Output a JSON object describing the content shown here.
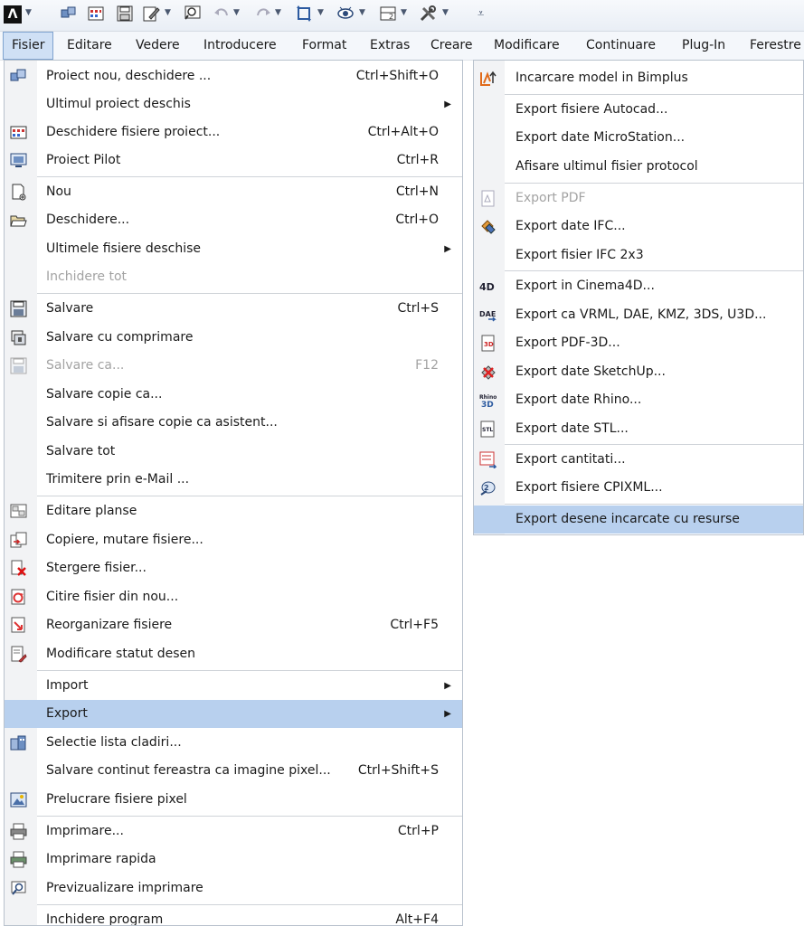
{
  "toolbar": {
    "logo": "Λ",
    "icons": [
      "cube-stack-icon",
      "grid-icon",
      "save-icon",
      "edit-icon",
      "search-icon",
      "undo-icon",
      "redo-icon",
      "rotate-icon",
      "eye-icon",
      "layer-icon",
      "tools-icon",
      "customize-icon"
    ]
  },
  "menubar": {
    "items": [
      "Fisier",
      "Editare",
      "Vedere",
      "Introducere",
      "Format",
      "Extras",
      "Creare",
      "Modificare",
      "Continuare",
      "Plug-In",
      "Ferestre"
    ]
  },
  "file_menu": {
    "items": [
      {
        "label": "Proiect nou, deschidere ...",
        "shortcut": "Ctrl+Shift+O",
        "icon": "project-icon",
        "disabled": false,
        "submenu": false
      },
      {
        "label": "Ultimul proiect deschis",
        "shortcut": "",
        "icon": "",
        "disabled": false,
        "submenu": true
      },
      {
        "label": "Deschidere fisiere proiect...",
        "shortcut": "Ctrl+Alt+O",
        "icon": "grid-icon",
        "disabled": false,
        "submenu": false
      },
      {
        "label": "Proiect Pilot",
        "shortcut": "Ctrl+R",
        "icon": "pilot-icon",
        "disabled": false,
        "submenu": false
      },
      {
        "label": "Nou",
        "shortcut": "Ctrl+N",
        "icon": "new-file-icon",
        "disabled": false,
        "submenu": false
      },
      {
        "label": "Deschidere...",
        "shortcut": "Ctrl+O",
        "icon": "open-folder-icon",
        "disabled": false,
        "submenu": false
      },
      {
        "label": "Ultimele fisiere deschise",
        "shortcut": "",
        "icon": "",
        "disabled": false,
        "submenu": true
      },
      {
        "label": "Inchidere tot",
        "shortcut": "",
        "icon": "",
        "disabled": true,
        "submenu": false
      },
      {
        "label": "Salvare",
        "shortcut": "Ctrl+S",
        "icon": "save-icon",
        "disabled": false,
        "submenu": false
      },
      {
        "label": "Salvare cu comprimare",
        "shortcut": "",
        "icon": "compress-icon",
        "disabled": false,
        "submenu": false
      },
      {
        "label": "Salvare ca...",
        "shortcut": "F12",
        "icon": "save-as-icon",
        "disabled": true,
        "submenu": false
      },
      {
        "label": "Salvare copie ca...",
        "shortcut": "",
        "icon": "",
        "disabled": false,
        "submenu": false
      },
      {
        "label": "Salvare si afisare copie ca asistent...",
        "shortcut": "",
        "icon": "",
        "disabled": false,
        "submenu": false
      },
      {
        "label": "Salvare tot",
        "shortcut": "",
        "icon": "",
        "disabled": false,
        "submenu": false
      },
      {
        "label": "Trimitere prin e-Mail ...",
        "shortcut": "",
        "icon": "",
        "disabled": false,
        "submenu": false
      },
      {
        "label": "Editare planse",
        "shortcut": "",
        "icon": "sheets-icon",
        "disabled": false,
        "submenu": false
      },
      {
        "label": "Copiere, mutare fisiere...",
        "shortcut": "",
        "icon": "copy-move-icon",
        "disabled": false,
        "submenu": false
      },
      {
        "label": "Stergere fisier...",
        "shortcut": "",
        "icon": "delete-file-icon",
        "disabled": false,
        "submenu": false
      },
      {
        "label": "Citire fisier din nou...",
        "shortcut": "",
        "icon": "reload-icon",
        "disabled": false,
        "submenu": false
      },
      {
        "label": "Reorganizare fisiere",
        "shortcut": "Ctrl+F5",
        "icon": "reorganize-icon",
        "disabled": false,
        "submenu": false
      },
      {
        "label": "Modificare statut desen",
        "shortcut": "",
        "icon": "status-icon",
        "disabled": false,
        "submenu": false
      },
      {
        "label": "Import",
        "shortcut": "",
        "icon": "",
        "disabled": false,
        "submenu": true
      },
      {
        "label": "Export",
        "shortcut": "",
        "icon": "",
        "disabled": false,
        "submenu": true,
        "highlighted": true
      },
      {
        "label": "Selectie lista cladiri...",
        "shortcut": "",
        "icon": "buildings-icon",
        "disabled": false,
        "submenu": false
      },
      {
        "label": "Salvare continut fereastra ca imagine pixel...",
        "shortcut": "Ctrl+Shift+S",
        "icon": "",
        "disabled": false,
        "submenu": false
      },
      {
        "label": "Prelucrare fisiere pixel",
        "shortcut": "",
        "icon": "image-icon",
        "disabled": false,
        "submenu": false
      },
      {
        "label": "Imprimare...",
        "shortcut": "Ctrl+P",
        "icon": "print-icon",
        "disabled": false,
        "submenu": false
      },
      {
        "label": "Imprimare rapida",
        "shortcut": "",
        "icon": "quick-print-icon",
        "disabled": false,
        "submenu": false
      },
      {
        "label": "Previzualizare imprimare",
        "shortcut": "",
        "icon": "print-preview-icon",
        "disabled": false,
        "submenu": false
      },
      {
        "label": "Inchidere program",
        "shortcut": "Alt+F4",
        "icon": "",
        "disabled": false,
        "submenu": false
      }
    ]
  },
  "export_submenu": {
    "items": [
      {
        "label": "Incarcare model in Bimplus",
        "icon": "bimplus-upload-icon",
        "disabled": false
      },
      {
        "label": "Export fisiere Autocad...",
        "icon": "",
        "disabled": false
      },
      {
        "label": "Export date MicroStation...",
        "icon": "",
        "disabled": false
      },
      {
        "label": "Afisare ultimul fisier protocol",
        "icon": "",
        "disabled": false
      },
      {
        "label": "Export PDF",
        "icon": "pdf-icon",
        "disabled": true
      },
      {
        "label": "Export date IFC...",
        "icon": "ifc-icon",
        "disabled": false
      },
      {
        "label": "Export  fisier IFC 2x3",
        "icon": "",
        "disabled": false
      },
      {
        "label": "Export in Cinema4D...",
        "icon": "cinema4d-icon",
        "disabled": false
      },
      {
        "label": "Export ca VRML, DAE, KMZ, 3DS, U3D...",
        "icon": "dae-icon",
        "disabled": false
      },
      {
        "label": "Export PDF-3D...",
        "icon": "pdf-3d-icon",
        "disabled": false
      },
      {
        "label": "Export date SketchUp...",
        "icon": "sketchup-icon",
        "disabled": false
      },
      {
        "label": "Export date Rhino...",
        "icon": "rhino-icon",
        "disabled": false
      },
      {
        "label": "Export date STL...",
        "icon": "stl-icon",
        "disabled": false
      },
      {
        "label": "Export cantitati...",
        "icon": "quantities-icon",
        "disabled": false
      },
      {
        "label": "Export fisiere CPIXML...",
        "icon": "cpixml-icon",
        "disabled": false
      },
      {
        "label": "Export desene incarcate cu resurse",
        "icon": "",
        "disabled": false,
        "highlighted": true
      }
    ]
  },
  "colors": {
    "highlight": "#b8d0ee",
    "gutter": "#f2f3f5",
    "disabled": "#a3a3a3",
    "menubar_active": "#cfe0f5"
  }
}
